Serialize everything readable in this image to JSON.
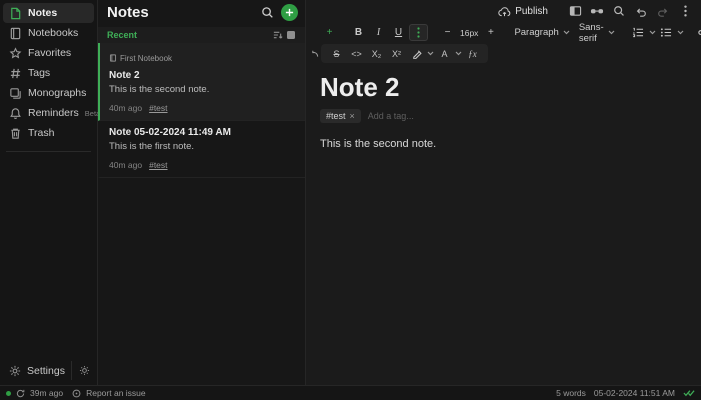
{
  "colors": {
    "accent": "#2f9e44",
    "accent_text": "#3fae57"
  },
  "sidebar": {
    "items": [
      {
        "label": "Notes"
      },
      {
        "label": "Notebooks"
      },
      {
        "label": "Favorites"
      },
      {
        "label": "Tags"
      },
      {
        "label": "Monographs"
      },
      {
        "label": "Reminders",
        "badge": "Beta"
      },
      {
        "label": "Trash"
      }
    ],
    "settings_label": "Settings"
  },
  "list_panel": {
    "title": "Notes",
    "group_header": "Recent",
    "notes": [
      {
        "notebook": "First Notebook",
        "title": "Note 2",
        "excerpt": "This is the second note.",
        "time": "40m ago",
        "tag": "#test"
      },
      {
        "title": "Note 05-02-2024 11:49 AM",
        "excerpt": "This is the first note.",
        "time": "40m ago",
        "tag": "#test"
      }
    ]
  },
  "editor": {
    "publish_label": "Publish",
    "toolbar": {
      "font_size": "16px",
      "paragraph": "Paragraph",
      "font_family": "Sans-serif",
      "glyphs": {
        "plus": "+",
        "bold": "B",
        "italic": "I",
        "underline": "U",
        "minus": "−",
        "size_plus": "+",
        "strike": "S",
        "code": "<>",
        "sub": "X₂",
        "sup": "X²",
        "color": "A",
        "math": "ƒx"
      }
    },
    "title": "Note 2",
    "tag_chip": {
      "label": "#test",
      "close": "×"
    },
    "tag_placeholder": "Add a tag...",
    "body": "This is the second note."
  },
  "statusbar": {
    "sync_status": "39m ago",
    "report_label": "Report an issue",
    "word_count": "5 words",
    "timestamp": "05-02-2024 11:51 AM"
  }
}
